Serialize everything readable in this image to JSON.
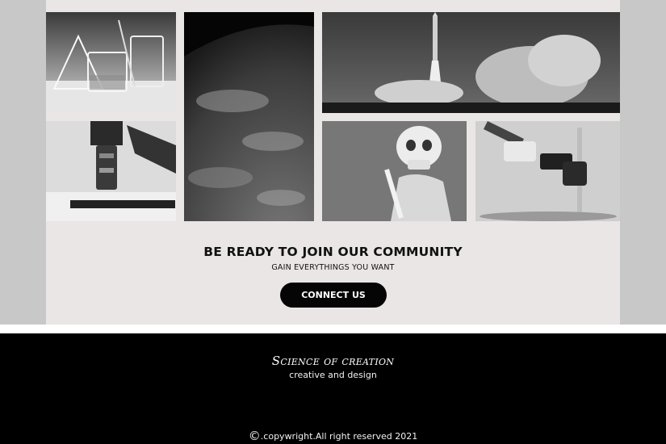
{
  "gallery": {
    "tiles": [
      {
        "subject": "lab glassware"
      },
      {
        "subject": "earth from space"
      },
      {
        "subject": "rocket launch"
      },
      {
        "subject": "microscope"
      },
      {
        "subject": "skeleton"
      },
      {
        "subject": "stereo microscope"
      }
    ]
  },
  "cta": {
    "title": "BE READY TO JOIN OUR COMMUNITY",
    "subtitle": "GAIN EVERYTHINGS YOU WANT",
    "button_label": "CONNECT US"
  },
  "footer": {
    "brand": "Science of creation",
    "tagline": "creative and design",
    "copyright_symbol": "©",
    "copyright_text": ".copywright.All right reserved 2021"
  },
  "colors": {
    "side_panels": "#c8c8c8",
    "main_panel": "#e9e6e5",
    "button": "#050505",
    "footer": "#000000"
  }
}
